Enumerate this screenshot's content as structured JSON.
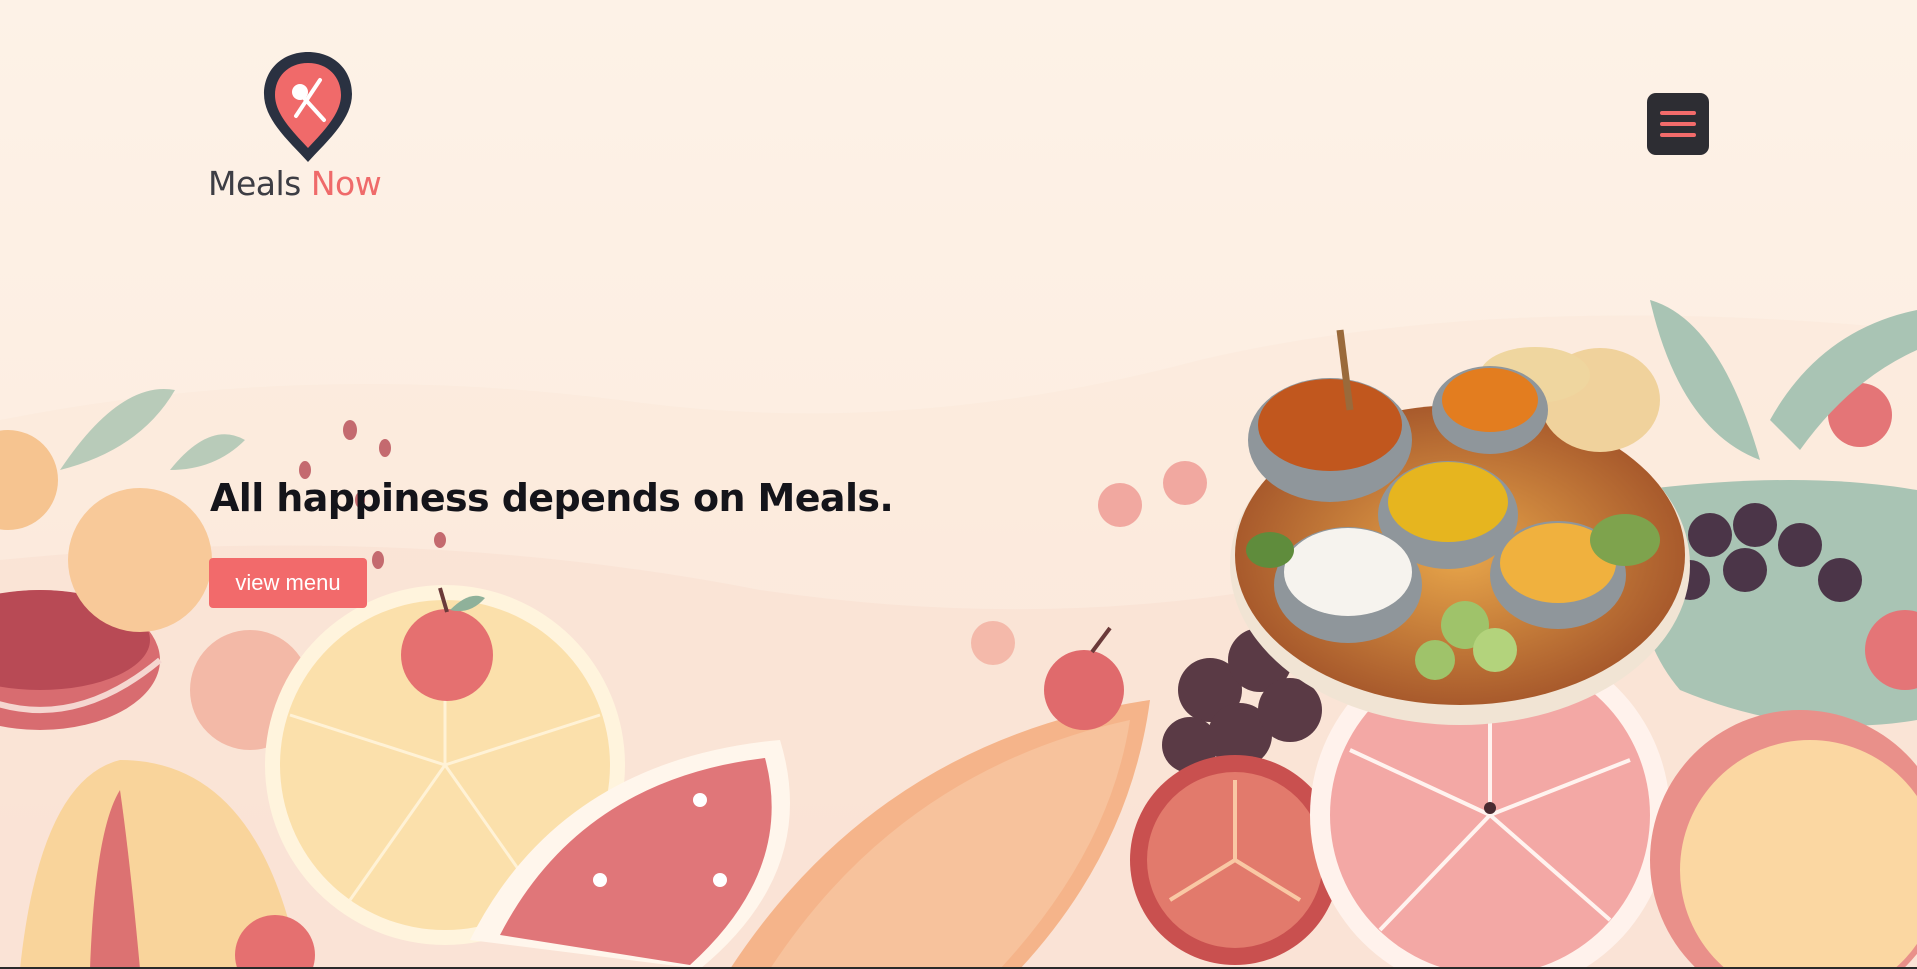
{
  "brand": {
    "logo_word_1": "Meals",
    "logo_word_2": "Now",
    "logo_icon": "location-pin-spoon-knife-icon",
    "colors": {
      "accent": "#f26a6b",
      "dark": "#2d2d33",
      "background": "#fdf1e6"
    }
  },
  "nav": {
    "menu_icon": "hamburger-menu-icon"
  },
  "hero": {
    "headline": "All happiness depends on Meals.",
    "cta_label": "view menu"
  },
  "illustration": {
    "subject": "thali-platter-and-fruits"
  }
}
